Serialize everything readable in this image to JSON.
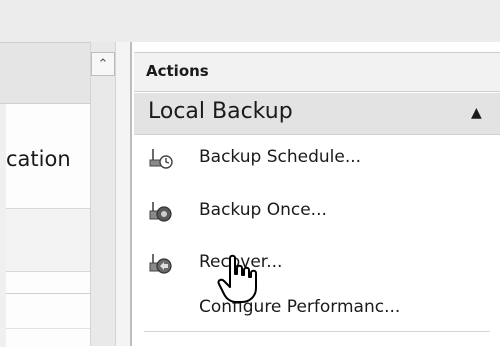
{
  "left_pane": {
    "visible_text": "cation"
  },
  "actions_pane": {
    "title": "Actions",
    "group": {
      "title": "Local Backup",
      "items": [
        {
          "label": "Backup Schedule...",
          "icon": "backup-schedule-icon"
        },
        {
          "label": "Backup Once...",
          "icon": "backup-once-icon"
        },
        {
          "label": "Recover...",
          "icon": "recover-icon"
        },
        {
          "label": "Configure Performanc...",
          "icon": ""
        }
      ]
    }
  },
  "colors": {
    "group_header_bg": "#e3e3e3",
    "pane_header_bg": "#f2f2f2",
    "text": "#1a1a1a"
  }
}
